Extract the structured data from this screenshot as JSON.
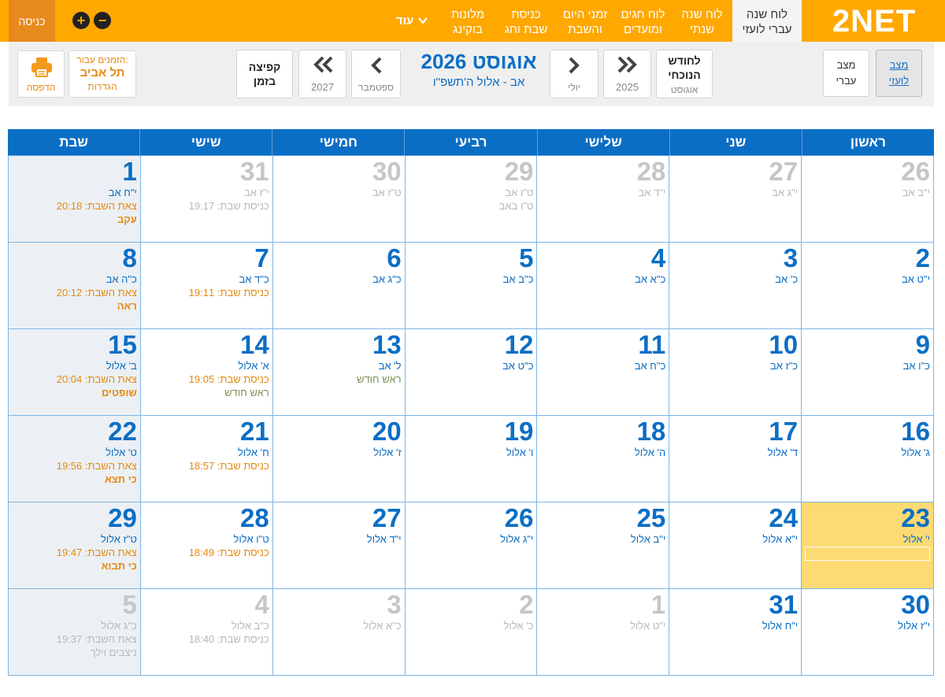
{
  "nav": {
    "logo": "2NET",
    "active": "לוח שנה\nעברי לועזי",
    "items": [
      {
        "label": "לוח שנה\nשנתי"
      },
      {
        "label": "לוח חגים\nומועדים"
      },
      {
        "label": "זמני היום\nוהשבת"
      },
      {
        "label": "כניסת\nשבת וחג"
      },
      {
        "label": "מלונות\nבוקינג"
      }
    ],
    "more": "עוד",
    "zoom_in": "+",
    "zoom_out": "−",
    "login": "כניסה"
  },
  "toolbar": {
    "mode_gregorian": "מצב\nלועזי",
    "mode_hebrew": "מצב\nעברי",
    "current_month": "לחודש\nהנוכחי",
    "current_month_sub": "אוגוסט",
    "prev_year": "2025",
    "prev_month": "יולי",
    "title": "אוגוסט 2026",
    "hebrew_range": "אב - אלול ה'תשפ\"ו",
    "next_month": "ספטמבר",
    "next_year": "2027",
    "jump": "קפיצה\nבזמן",
    "city_pre": "הזמנים עבור:",
    "city": "תל אביב",
    "settings": "הגדרות",
    "print": "הדפסה"
  },
  "calendar": {
    "days": [
      "ראשון",
      "שני",
      "שלישי",
      "רביעי",
      "חמישי",
      "שישי",
      "שבת"
    ],
    "weeks": [
      [
        {
          "d": "26",
          "h": "י\"ב אב",
          "other": true
        },
        {
          "d": "27",
          "h": "י\"ג אב",
          "other": true
        },
        {
          "d": "28",
          "h": "י\"ד אב",
          "other": true
        },
        {
          "d": "29",
          "h": "ט\"ו אב",
          "event": "ט\"ו באב",
          "other": true
        },
        {
          "d": "30",
          "h": "ט\"ז אב",
          "other": true
        },
        {
          "d": "31",
          "h": "י\"ז אב",
          "line": "כניסת שבת: 19:17",
          "other": true
        },
        {
          "d": "1",
          "h": "י\"ח אב",
          "line": "צאת השבת: 20:18",
          "parasha": "עקב"
        }
      ],
      [
        {
          "d": "2",
          "h": "י\"ט אב"
        },
        {
          "d": "3",
          "h": "כ' אב"
        },
        {
          "d": "4",
          "h": "כ\"א אב"
        },
        {
          "d": "5",
          "h": "כ\"ב אב"
        },
        {
          "d": "6",
          "h": "כ\"ג אב"
        },
        {
          "d": "7",
          "h": "כ\"ד אב",
          "line": "כניסת שבת: 19:11"
        },
        {
          "d": "8",
          "h": "כ\"ה אב",
          "line": "צאת השבת: 20:12",
          "parasha": "ראה"
        }
      ],
      [
        {
          "d": "9",
          "h": "כ\"ו אב"
        },
        {
          "d": "10",
          "h": "כ\"ז אב"
        },
        {
          "d": "11",
          "h": "כ\"ח אב"
        },
        {
          "d": "12",
          "h": "כ\"ט אב"
        },
        {
          "d": "13",
          "h": "ל' אב",
          "event": "ראש חודש"
        },
        {
          "d": "14",
          "h": "א' אלול",
          "line": "כניסת שבת: 19:05",
          "event": "ראש חודש"
        },
        {
          "d": "15",
          "h": "ב' אלול",
          "line": "צאת השבת: 20:04",
          "parasha": "שופטים"
        }
      ],
      [
        {
          "d": "16",
          "h": "ג' אלול"
        },
        {
          "d": "17",
          "h": "ד' אלול"
        },
        {
          "d": "18",
          "h": "ה' אלול"
        },
        {
          "d": "19",
          "h": "ו' אלול"
        },
        {
          "d": "20",
          "h": "ז' אלול"
        },
        {
          "d": "21",
          "h": "ח' אלול",
          "line": "כניסת שבת: 18:57"
        },
        {
          "d": "22",
          "h": "ט' אלול",
          "line": "צאת השבת: 19:56",
          "parasha": "כי תצא"
        }
      ],
      [
        {
          "d": "23",
          "h": "י' אלול",
          "today": true
        },
        {
          "d": "24",
          "h": "י\"א אלול"
        },
        {
          "d": "25",
          "h": "י\"ב אלול"
        },
        {
          "d": "26",
          "h": "י\"ג אלול"
        },
        {
          "d": "27",
          "h": "י\"ד אלול"
        },
        {
          "d": "28",
          "h": "ט\"ו אלול",
          "line": "כניסת שבת: 18:49"
        },
        {
          "d": "29",
          "h": "ט\"ז אלול",
          "line": "צאת השבת: 19:47",
          "parasha": "כי תבוא"
        }
      ],
      [
        {
          "d": "30",
          "h": "י\"ז אלול"
        },
        {
          "d": "31",
          "h": "י\"ח אלול"
        },
        {
          "d": "1",
          "h": "י\"ט אלול",
          "other": true
        },
        {
          "d": "2",
          "h": "כ' אלול",
          "other": true
        },
        {
          "d": "3",
          "h": "כ\"א אלול",
          "other": true
        },
        {
          "d": "4",
          "h": "כ\"ב אלול",
          "line": "כניסת שבת: 18:40",
          "other": true
        },
        {
          "d": "5",
          "h": "כ\"ג אלול",
          "line": "צאת השבת: 19:37",
          "parasha": "ניצבים וילך",
          "other": true
        }
      ]
    ]
  },
  "colors": {
    "orange": "#ffa800",
    "blue": "#0b6ec5",
    "today": "#fdda73"
  }
}
